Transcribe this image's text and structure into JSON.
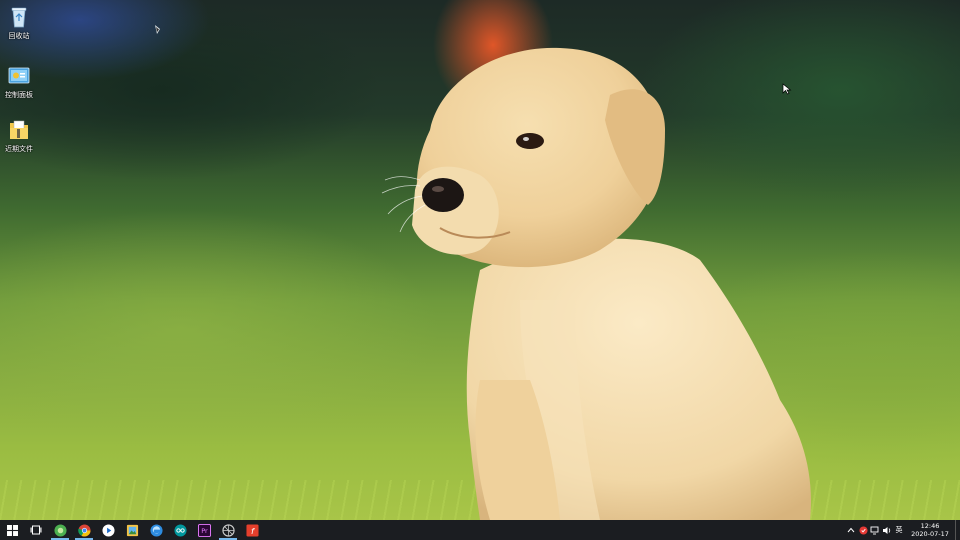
{
  "desktop": {
    "icons": [
      {
        "name": "recycle-bin",
        "label": "回收站",
        "icon": "recycle-bin-icon"
      },
      {
        "name": "control-panel",
        "label": "控制面板",
        "icon": "control-panel-icon"
      },
      {
        "name": "recent-files",
        "label": "近期文件",
        "icon": "folder-icon"
      }
    ],
    "colors": {
      "sky_orange": "#ea5828",
      "grass": "#86ab40",
      "puppy_fur": "#efd3a0"
    }
  },
  "taskbar": {
    "start_icon": "windows-start-icon",
    "task_view_icon": "task-view-icon",
    "pinned": [
      {
        "name": "app-green",
        "icon": "green-app-icon",
        "active": true
      },
      {
        "name": "chrome",
        "icon": "chrome-icon",
        "active": true
      },
      {
        "name": "media-player",
        "icon": "play-icon",
        "active": false
      },
      {
        "name": "image-viewer",
        "icon": "image-viewer-icon",
        "active": false
      },
      {
        "name": "browser",
        "icon": "browser-icon",
        "active": false
      },
      {
        "name": "arduino",
        "icon": "arduino-icon",
        "active": false
      },
      {
        "name": "premiere",
        "icon": "premiere-icon",
        "active": false,
        "text": "Pr"
      },
      {
        "name": "network-tool",
        "icon": "network-tool-icon",
        "active": true
      },
      {
        "name": "red-app",
        "icon": "red-app-icon",
        "active": false,
        "text": "f"
      }
    ],
    "tray": {
      "ime_label": "英",
      "time": "12:46",
      "date": "2020-07-17"
    },
    "colors": {
      "background": "#1b1d21",
      "active_indicator": "#76b9ed"
    }
  }
}
